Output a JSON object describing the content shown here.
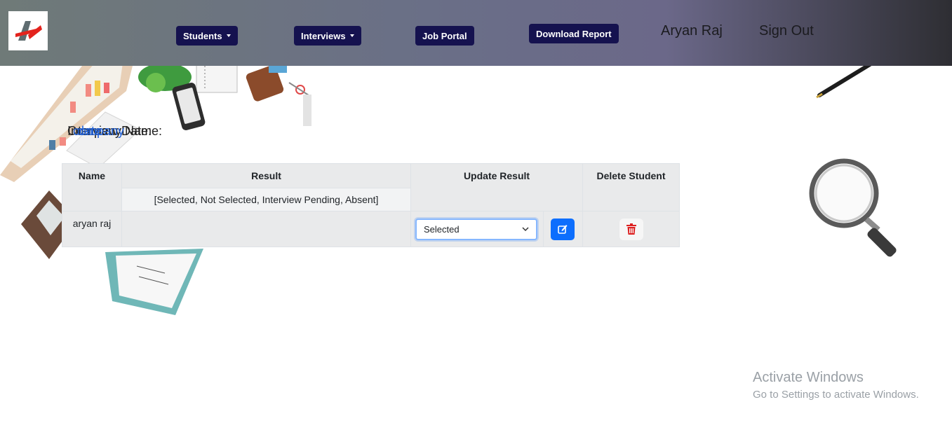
{
  "navbar": {
    "students_label": "Students",
    "interviews_label": "Interviews",
    "job_portal_label": "Job Portal",
    "download_report_label": "Download Report",
    "user_name": "Aryan Raj",
    "sign_out_label": "Sign Out"
  },
  "info": {
    "company_label": "Company Name:",
    "date_label": "Interview Date:",
    "overlay_text_1": "company",
    "overlay_text_2": "date"
  },
  "table": {
    "headers": {
      "name": "Name",
      "result": "Result",
      "update_result": "Update Result",
      "delete_student": "Delete Student"
    },
    "result_options_note": "[Selected, Not Selected, Interview Pending, Absent]",
    "rows": [
      {
        "name": "aryan raj",
        "result": "",
        "selected_value": "Selected"
      }
    ]
  },
  "colors": {
    "nav_button": "#15124f",
    "edit_button": "#0d6efd",
    "delete_icon": "#dc1f1f"
  },
  "watermark": {
    "title": "Activate Windows",
    "subtitle": "Go to Settings to activate Windows."
  }
}
